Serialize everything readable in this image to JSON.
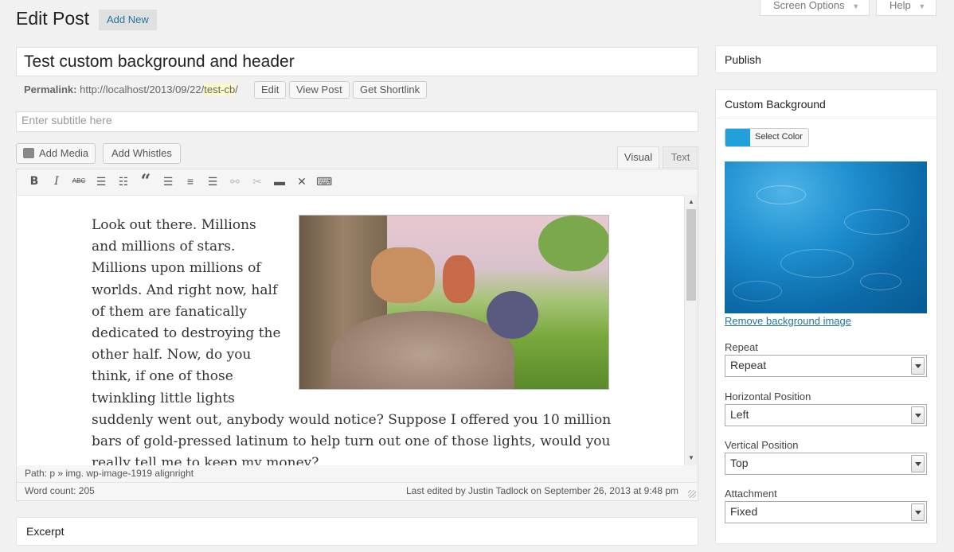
{
  "header": {
    "title": "Edit Post",
    "add_new": "Add New",
    "screen_options": "Screen Options",
    "help": "Help"
  },
  "post": {
    "title": "Test custom background and header",
    "permalink_label": "Permalink:",
    "permalink_base": "http://localhost/2013/09/22/",
    "permalink_slug": "test-cb",
    "permalink_tail": "/",
    "edit_btn": "Edit",
    "view_btn": "View Post",
    "shortlink_btn": "Get Shortlink",
    "subtitle_placeholder": "Enter subtitle here"
  },
  "editor": {
    "add_media": "Add Media",
    "add_whistles": "Add Whistles",
    "tab_visual": "Visual",
    "tab_text": "Text",
    "content_lines": [
      "Look out there. Millions",
      "and millions of stars.",
      "Millions upon millions of",
      "worlds. And right now, half",
      "of them are fanatically",
      "dedicated to destroying the",
      "other half. Now, do you",
      "think, if one of those",
      "twinkling little lights",
      "suddenly went out, anybody would notice? Suppose I offered you 10 million",
      "bars of gold-pressed latinum to help turn out one of those lights, would you",
      "really tell me to keep my money?"
    ],
    "path": "Path: p » img. wp-image-1919 alignright",
    "word_count": "Word count: 205",
    "last_edited": "Last edited by Justin Tadlock on September 26, 2013 at 9:48 pm"
  },
  "excerpt": {
    "title": "Excerpt"
  },
  "sidebar": {
    "publish_title": "Publish",
    "bg_title": "Custom Background",
    "select_color": "Select Color",
    "color_swatch": "#21a1d9",
    "remove_bg": "Remove background image",
    "repeat_label": "Repeat",
    "repeat_value": "Repeat",
    "hpos_label": "Horizontal Position",
    "hpos_value": "Left",
    "vpos_label": "Vertical Position",
    "vpos_value": "Top",
    "attach_label": "Attachment",
    "attach_value": "Fixed"
  }
}
